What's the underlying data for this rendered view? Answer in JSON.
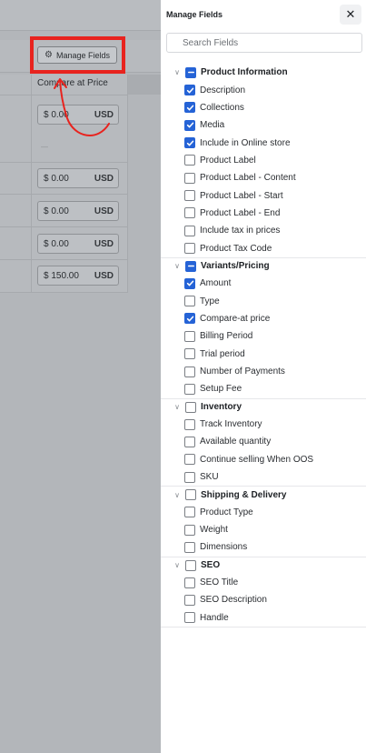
{
  "background": {
    "manage_fields_button_label": "Manage Fields",
    "column_header": "Compare at Price",
    "dash": "—",
    "rows": [
      {
        "amount": "$ 0.00",
        "currency": "USD"
      },
      {
        "amount": "$ 0.00",
        "currency": "USD"
      },
      {
        "amount": "$ 0.00",
        "currency": "USD"
      },
      {
        "amount": "$ 0.00",
        "currency": "USD"
      },
      {
        "amount": "$ 150.00",
        "currency": "USD"
      }
    ]
  },
  "panel": {
    "title": "Manage Fields",
    "close_symbol": "✕",
    "search_placeholder": "Search Fields",
    "groups": [
      {
        "label": "Product Information",
        "state": "indeterminate",
        "items": [
          {
            "label": "Description",
            "checked": true
          },
          {
            "label": "Collections",
            "checked": true
          },
          {
            "label": "Media",
            "checked": true
          },
          {
            "label": "Include in Online store",
            "checked": true
          },
          {
            "label": "Product Label",
            "checked": false
          },
          {
            "label": "Product Label - Content",
            "checked": false
          },
          {
            "label": "Product Label - Start",
            "checked": false
          },
          {
            "label": "Product Label - End",
            "checked": false
          },
          {
            "label": "Include tax in prices",
            "checked": false
          },
          {
            "label": "Product Tax Code",
            "checked": false
          }
        ]
      },
      {
        "label": "Variants/Pricing",
        "state": "indeterminate",
        "items": [
          {
            "label": "Amount",
            "checked": true
          },
          {
            "label": "Type",
            "checked": false
          },
          {
            "label": "Compare-at price",
            "checked": true
          },
          {
            "label": "Billing Period",
            "checked": false
          },
          {
            "label": "Trial period",
            "checked": false
          },
          {
            "label": "Number of Payments",
            "checked": false
          },
          {
            "label": "Setup Fee",
            "checked": false
          }
        ]
      },
      {
        "label": "Inventory",
        "state": "unchecked",
        "items": [
          {
            "label": "Track Inventory",
            "checked": false
          },
          {
            "label": "Available quantity",
            "checked": false
          },
          {
            "label": "Continue selling When OOS",
            "checked": false
          },
          {
            "label": "SKU",
            "checked": false
          }
        ]
      },
      {
        "label": "Shipping & Delivery",
        "state": "unchecked",
        "items": [
          {
            "label": "Product Type",
            "checked": false
          },
          {
            "label": "Weight",
            "checked": false
          },
          {
            "label": "Dimensions",
            "checked": false
          }
        ]
      },
      {
        "label": "SEO",
        "state": "unchecked",
        "items": [
          {
            "label": "SEO Title",
            "checked": false
          },
          {
            "label": "SEO Description",
            "checked": false
          },
          {
            "label": "Handle",
            "checked": false
          }
        ]
      }
    ]
  },
  "colors": {
    "accent": "#2563d6",
    "highlight": "#e8231e",
    "overlay": "#b3b6ba"
  }
}
